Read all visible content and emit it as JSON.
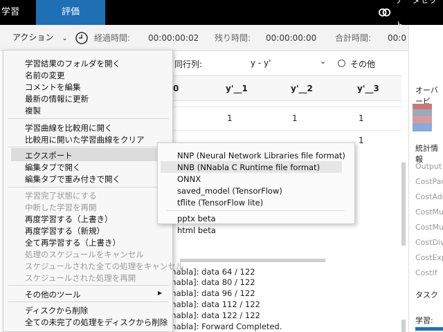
{
  "topbar": {
    "tab_train": "学習",
    "tab_eval": "評価",
    "dataset": "データセット"
  },
  "toolbar": {
    "action": "アクション",
    "elapsed_label": "経過時間:",
    "elapsed_value": "00:00:00:02",
    "remaining_label": "残り時間:",
    "remaining_value": "00:00:00:00",
    "total_label": "合計時間:",
    "total_value": "00:0"
  },
  "filter": {
    "label": "同行列:",
    "value": "y - y'",
    "radio_label": "その他"
  },
  "table": {
    "headers": [
      "0",
      "y'__1",
      "y'__2",
      "y'__3"
    ],
    "rows": [
      [
        "",
        "1",
        "1",
        "1"
      ],
      [
        "",
        "1",
        "1",
        "1"
      ]
    ]
  },
  "right": {
    "overview": "オーバービ",
    "stats": "統計情報",
    "items": [
      "Output",
      "CostPar",
      "CostAdd",
      "CostMu",
      "CostMu",
      "CostDiv",
      "CostExp",
      "CostIf"
    ],
    "task": "タスク",
    "train": "学習:"
  },
  "log": [
    "nnabla]: data 64 / 122",
    "nnabla]: data 80 / 122",
    "nnabla]: data 96 / 122",
    "nnabla]: data 112 / 122",
    "nnabla]: data 122 / 122",
    "nnabla]: Forward Completed."
  ],
  "menu": {
    "g1": [
      "学習結果のフォルダを開く",
      "名前の変更",
      "コメントを編集",
      "最新の情報に更新",
      "複製"
    ],
    "g2": [
      "学習曲線を比較用に開く",
      "比較用に開いた学習曲線をクリア"
    ],
    "g3": [
      "エクスポート",
      "編集タブで開く",
      "編集タブで重み付きで開く"
    ],
    "g4": [
      "学習完了状態にする",
      "中断した学習を再開",
      "再度学習する（上書き）",
      "再度学習する（新規）",
      "全て再学習する（上書き）",
      "処理のスケジュールをキャンセル",
      "スケジュールされた全ての処理をキャンセル",
      "スケジュールされた処理を再開"
    ],
    "g5": [
      "その他のツール"
    ],
    "g6": [
      "ディスクから削除",
      "全ての未完了の処理をディスクから削除"
    ]
  },
  "submenu": [
    "NNP (Neural Network Libraries file format)",
    "NNB (NNabla C Runtime file format)",
    "ONNX",
    "saved_model (TensorFlow)",
    "tflite (TensorFlow lite)",
    "pptx beta",
    "html beta"
  ]
}
